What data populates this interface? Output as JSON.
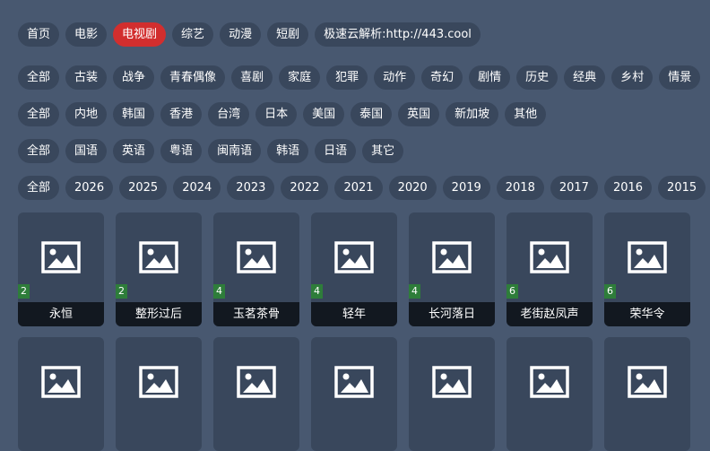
{
  "top_nav": {
    "tabs": [
      "首页",
      "电影",
      "电视剧",
      "综艺",
      "动漫",
      "短剧"
    ],
    "active_tab": "电视剧",
    "source": "极速云解析:http://443.cool"
  },
  "filters": {
    "genre": [
      "全部",
      "古装",
      "战争",
      "青春偶像",
      "喜剧",
      "家庭",
      "犯罪",
      "动作",
      "奇幻",
      "剧情",
      "历史",
      "经典",
      "乡村",
      "情景"
    ],
    "region": [
      "全部",
      "内地",
      "韩国",
      "香港",
      "台湾",
      "日本",
      "美国",
      "泰国",
      "英国",
      "新加坡",
      "其他"
    ],
    "language": [
      "全部",
      "国语",
      "英语",
      "粤语",
      "闽南语",
      "韩语",
      "日语",
      "其它"
    ],
    "year": [
      "全部",
      "2026",
      "2025",
      "2024",
      "2023",
      "2022",
      "2021",
      "2020",
      "2019",
      "2018",
      "2017",
      "2016",
      "2015"
    ]
  },
  "cards": [
    {
      "title": "永恒",
      "badge": "2"
    },
    {
      "title": "整形过后",
      "badge": "2"
    },
    {
      "title": "玉茗茶骨",
      "badge": "4"
    },
    {
      "title": "轻年",
      "badge": "4"
    },
    {
      "title": "长河落日",
      "badge": "4"
    },
    {
      "title": "老街赵凤声",
      "badge": "6"
    },
    {
      "title": "荣华令",
      "badge": "6"
    }
  ],
  "icons": {
    "poster_placeholder": "image-placeholder-icon"
  },
  "colors": {
    "background": "#485870",
    "chip": "#39475c",
    "active": "#d22e2e",
    "badge": "#2e7d3a"
  }
}
